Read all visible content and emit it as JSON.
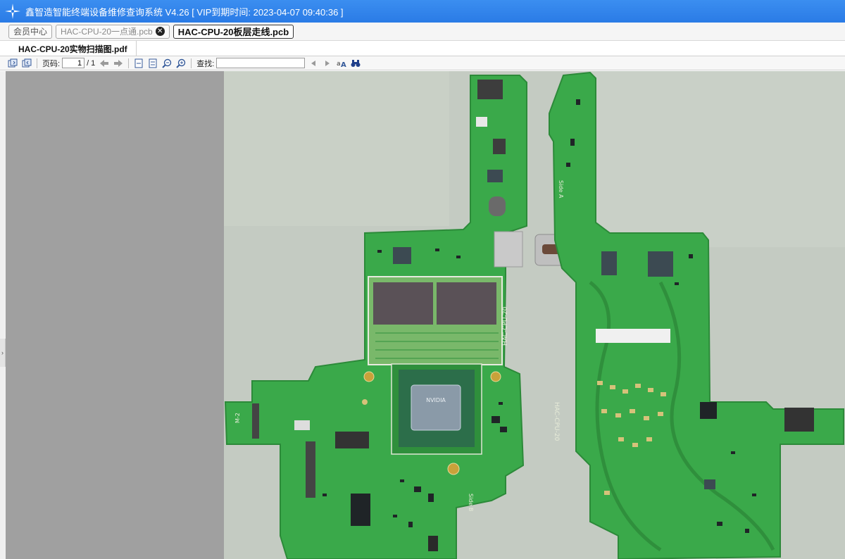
{
  "app": {
    "title": "鑫智造智能终端设备维修查询系统 V4.26 [ VIP到期时间: 2023-04-07 09:40:36 ]"
  },
  "doc_tabs": [
    {
      "label": "会员中心"
    },
    {
      "label": "HAC-CPU-20一点通.pcb"
    },
    {
      "label": "HAC-CPU-20板层走线.pcb"
    }
  ],
  "file_tab": {
    "label": "HAC-CPU-20实物扫描图.pdf"
  },
  "toolbar": {
    "page_label": "页码:",
    "page_current": "1",
    "page_total": "/ 1",
    "find_label": "查找:",
    "search_value": ""
  },
  "icons": {
    "app_logo": "star-compass-icon",
    "tab_close": "close-circle-icon",
    "toolbar": [
      "save-icon",
      "save-as-icon",
      "nav-back-icon",
      "nav-forward-icon",
      "fit-page-icon",
      "fit-width-icon",
      "zoom-out-icon",
      "zoom-in-icon",
      "find-prev-icon",
      "find-next-icon",
      "match-case-icon",
      "binoculars-icon"
    ]
  },
  "pcb": {
    "left_board_label": "HAC-CPU-20",
    "right_board_label": "HAC-CPU-20",
    "side_a_label": "Side A",
    "side_b_label": "Side B",
    "chip_mark": "NVIDIA",
    "m2_label": "M-2",
    "colors": {
      "board": "#3aa94a",
      "board_dark": "#2f8f3c",
      "background": "#c4cbc2",
      "chip": "#3c4a52",
      "ram": "#5a5157"
    }
  }
}
